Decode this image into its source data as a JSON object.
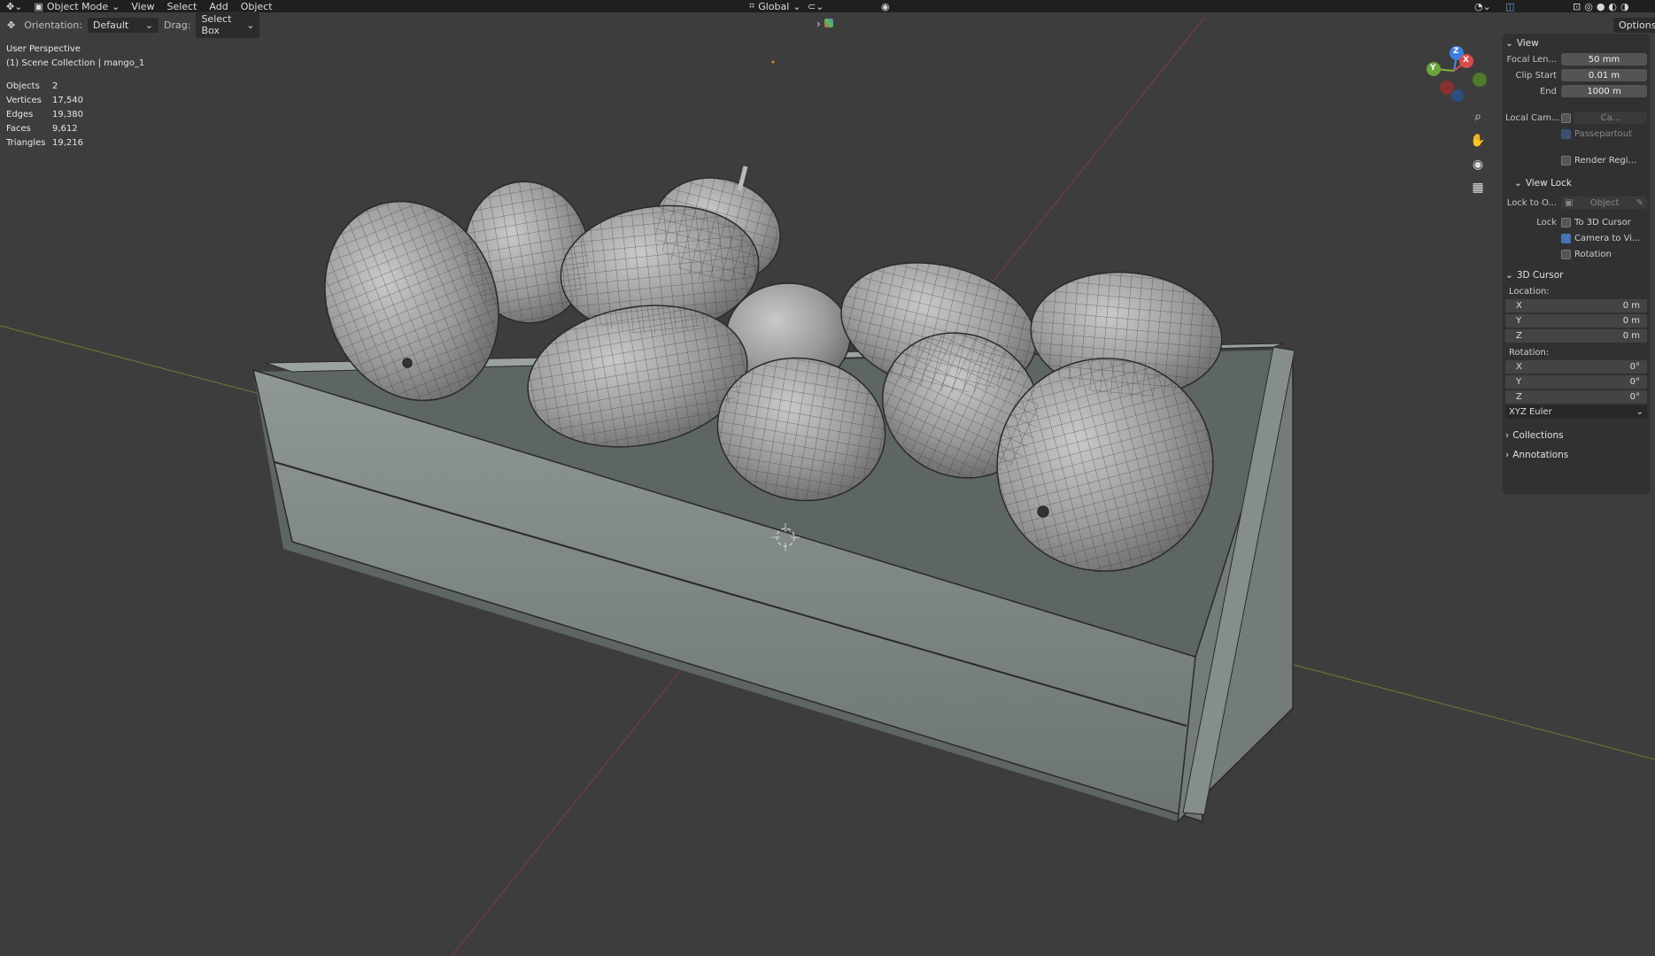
{
  "topbar": {
    "mode": "Object Mode",
    "menus": [
      "View",
      "Select",
      "Add",
      "Object"
    ],
    "transform": "Global"
  },
  "toolbar2": {
    "orientation_label": "Orientation:",
    "orientation_value": "Default",
    "drag_label": "Drag:",
    "drag_value": "Select Box"
  },
  "options_label": "Options",
  "overlay": {
    "view_name": "User Perspective",
    "collection": "(1) Scene Collection | mango_1",
    "stats": [
      {
        "label": "Objects",
        "value": "2"
      },
      {
        "label": "Vertices",
        "value": "17,540"
      },
      {
        "label": "Edges",
        "value": "19,380"
      },
      {
        "label": "Faces",
        "value": "9,612"
      },
      {
        "label": "Triangles",
        "value": "19,216"
      }
    ]
  },
  "gizmo": {
    "x": "X",
    "y": "Y",
    "z": "Z"
  },
  "npanel": {
    "view_header": "View",
    "focal_label": "Focal Len...",
    "focal_value": "50 mm",
    "clip_start_label": "Clip Start",
    "clip_start_value": "0.01 m",
    "end_label": "End",
    "end_value": "1000 m",
    "local_cam_label": "Local Cam...",
    "local_cam_value": "Ca...",
    "passepartout": "Passepartout",
    "render_region": "Render Regi...",
    "view_lock_header": "View Lock",
    "lock_to_label": "Lock to O...",
    "lock_to_value": "Object",
    "lock_label": "Lock",
    "lock_cursor": "To 3D Cursor",
    "lock_camera": "Camera to Vi...",
    "lock_rotation": "Rotation",
    "cursor_header": "3D Cursor",
    "location_label": "Location:",
    "loc": [
      {
        "axis": "X",
        "value": "0 m"
      },
      {
        "axis": "Y",
        "value": "0 m"
      },
      {
        "axis": "Z",
        "value": "0 m"
      }
    ],
    "rotation_label": "Rotation:",
    "rot": [
      {
        "axis": "X",
        "value": "0°"
      },
      {
        "axis": "Y",
        "value": "0°"
      },
      {
        "axis": "Z",
        "value": "0°"
      }
    ],
    "rotation_mode": "XYZ Euler",
    "collections_header": "Collections",
    "annotations_header": "Annotations"
  }
}
